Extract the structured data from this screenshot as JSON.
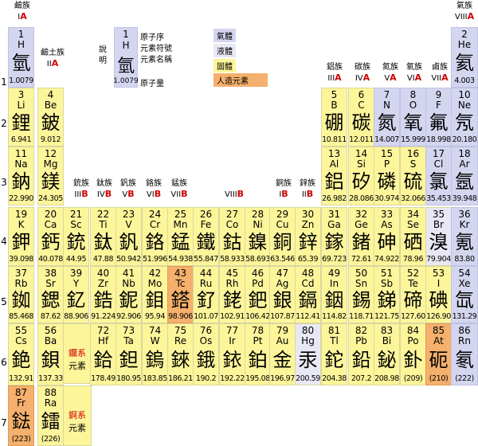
{
  "top_groups": {
    "g1": {
      "cj": "鹼族",
      "rm": "I",
      "ab": "A"
    },
    "g2": {
      "cj": "鹼土族",
      "rm": "II",
      "ab": "A"
    },
    "g13": {
      "cj": "鋁族",
      "rm": "III",
      "ab": "A"
    },
    "g14": {
      "cj": "碳族",
      "rm": "IV",
      "ab": "A"
    },
    "g15": {
      "cj": "氮族",
      "rm": "V",
      "ab": "A"
    },
    "g16": {
      "cj": "氧族",
      "rm": "VI",
      "ab": "A"
    },
    "g17": {
      "cj": "鹵族",
      "rm": "VII",
      "ab": "A"
    },
    "g18": {
      "cj": "氣族",
      "rm": "VIII",
      "ab": "A"
    }
  },
  "transition_groups": [
    {
      "cj": "銃族",
      "rm": "III",
      "ab": "B"
    },
    {
      "cj": "鈦族",
      "rm": "IV",
      "ab": "B"
    },
    {
      "cj": "釩族",
      "rm": "V",
      "ab": "B"
    },
    {
      "cj": "鉻族",
      "rm": "VI",
      "ab": "B"
    },
    {
      "cj": "錳族",
      "rm": "VII",
      "ab": "B"
    },
    {
      "cj": "",
      "rm": "VIII",
      "ab": "B"
    },
    {
      "cj": "銅族",
      "rm": "I",
      "ab": "B"
    },
    {
      "cj": "鋅族",
      "rm": "II",
      "ab": "B"
    }
  ],
  "legend": {
    "side_label": "說明",
    "sample": {
      "num": "1",
      "sym": "H",
      "han": "氫",
      "mass": "1.0079"
    },
    "l1": "原子序",
    "l2": "元素符號",
    "l3": "元素名稱",
    "l4": "原子量",
    "gas": "氣體",
    "liquid": "液體",
    "solid": "固體",
    "synthetic": "人造元素",
    "gas_color": "#d4d6f0",
    "liquid_color": "#e8e8f4",
    "solid_color": "#fdf59a",
    "synth_color": "#f4b06c"
  },
  "row_numbers": [
    "1",
    "2",
    "3",
    "4",
    "5",
    "6",
    "7"
  ],
  "series": {
    "lanthanide": {
      "l1": "鑭系",
      "l2": "元素"
    },
    "actinide": {
      "l1": "錒系",
      "l2": "元素"
    }
  },
  "elements": [
    {
      "n": "1",
      "s": "H",
      "h": "氫",
      "m": "1.0079",
      "r": 1,
      "c": 1,
      "t": "gas"
    },
    {
      "n": "2",
      "s": "He",
      "h": "氦",
      "m": "4.003",
      "r": 1,
      "c": 18,
      "t": "gas"
    },
    {
      "n": "3",
      "s": "Li",
      "h": "鋰",
      "m": "6.941",
      "r": 2,
      "c": 1,
      "t": "solid"
    },
    {
      "n": "4",
      "s": "Be",
      "h": "鈹",
      "m": "9.012",
      "r": 2,
      "c": 2,
      "t": "solid"
    },
    {
      "n": "5",
      "s": "B",
      "h": "硼",
      "m": "10.811",
      "r": 2,
      "c": 13,
      "t": "solid"
    },
    {
      "n": "6",
      "s": "C",
      "h": "碳",
      "m": "12.011",
      "r": 2,
      "c": 14,
      "t": "solid"
    },
    {
      "n": "7",
      "s": "N",
      "h": "氮",
      "m": "14.007",
      "r": 2,
      "c": 15,
      "t": "gas"
    },
    {
      "n": "8",
      "s": "O",
      "h": "氧",
      "m": "15.999",
      "r": 2,
      "c": 16,
      "t": "gas"
    },
    {
      "n": "9",
      "s": "F",
      "h": "氟",
      "m": "18.998",
      "r": 2,
      "c": 17,
      "t": "gas"
    },
    {
      "n": "10",
      "s": "Ne",
      "h": "氖",
      "m": "20.180",
      "r": 2,
      "c": 18,
      "t": "gas"
    },
    {
      "n": "11",
      "s": "Na",
      "h": "鈉",
      "m": "22.990",
      "r": 3,
      "c": 1,
      "t": "solid"
    },
    {
      "n": "12",
      "s": "Mg",
      "h": "鎂",
      "m": "24.305",
      "r": 3,
      "c": 2,
      "t": "solid"
    },
    {
      "n": "13",
      "s": "Al",
      "h": "鋁",
      "m": "26.982",
      "r": 3,
      "c": 13,
      "t": "solid"
    },
    {
      "n": "14",
      "s": "Si",
      "h": "矽",
      "m": "28.086",
      "r": 3,
      "c": 14,
      "t": "solid"
    },
    {
      "n": "15",
      "s": "P",
      "h": "磷",
      "m": "30.974",
      "r": 3,
      "c": 15,
      "t": "solid"
    },
    {
      "n": "16",
      "s": "S",
      "h": "硫",
      "m": "32.066",
      "r": 3,
      "c": 16,
      "t": "solid"
    },
    {
      "n": "17",
      "s": "Cl",
      "h": "氯",
      "m": "35.453",
      "r": 3,
      "c": 17,
      "t": "gas"
    },
    {
      "n": "18",
      "s": "Ar",
      "h": "氬",
      "m": "39.948",
      "r": 3,
      "c": 18,
      "t": "gas"
    },
    {
      "n": "19",
      "s": "K",
      "h": "鉀",
      "m": "39.098",
      "r": 4,
      "c": 1,
      "t": "solid"
    },
    {
      "n": "20",
      "s": "Ca",
      "h": "鈣",
      "m": "40.078",
      "r": 4,
      "c": 2,
      "t": "solid"
    },
    {
      "n": "21",
      "s": "Sc",
      "h": "銃",
      "m": "44.95",
      "r": 4,
      "c": 3,
      "t": "solid"
    },
    {
      "n": "22",
      "s": "Ti",
      "h": "鈦",
      "m": "47.88",
      "r": 4,
      "c": 4,
      "t": "solid"
    },
    {
      "n": "23",
      "s": "V",
      "h": "釩",
      "m": "50.942",
      "r": 4,
      "c": 5,
      "t": "solid"
    },
    {
      "n": "24",
      "s": "Cr",
      "h": "鉻",
      "m": "51.996",
      "r": 4,
      "c": 6,
      "t": "solid"
    },
    {
      "n": "25",
      "s": "Mn",
      "h": "錳",
      "m": "54.938",
      "r": 4,
      "c": 7,
      "t": "solid"
    },
    {
      "n": "26",
      "s": "Fe",
      "h": "鐵",
      "m": "55.847",
      "r": 4,
      "c": 8,
      "t": "solid"
    },
    {
      "n": "27",
      "s": "Co",
      "h": "鈷",
      "m": "58.933",
      "r": 4,
      "c": 9,
      "t": "solid"
    },
    {
      "n": "28",
      "s": "Ni",
      "h": "鎳",
      "m": "58.693",
      "r": 4,
      "c": 10,
      "t": "solid"
    },
    {
      "n": "29",
      "s": "Cu",
      "h": "銅",
      "m": "63.546",
      "r": 4,
      "c": 11,
      "t": "solid"
    },
    {
      "n": "30",
      "s": "Zn",
      "h": "鋅",
      "m": "65.39",
      "r": 4,
      "c": 12,
      "t": "solid"
    },
    {
      "n": "31",
      "s": "Ga",
      "h": "鎵",
      "m": "69.723",
      "r": 4,
      "c": 13,
      "t": "solid"
    },
    {
      "n": "32",
      "s": "Ge",
      "h": "鍺",
      "m": "72.61",
      "r": 4,
      "c": 14,
      "t": "solid"
    },
    {
      "n": "33",
      "s": "As",
      "h": "砷",
      "m": "74.922",
      "r": 4,
      "c": 15,
      "t": "solid"
    },
    {
      "n": "34",
      "s": "Se",
      "h": "硒",
      "m": "78.96",
      "r": 4,
      "c": 16,
      "t": "solid"
    },
    {
      "n": "35",
      "s": "Br",
      "h": "溴",
      "m": "79.904",
      "r": 4,
      "c": 17,
      "t": "liquid"
    },
    {
      "n": "36",
      "s": "Kr",
      "h": "氪",
      "m": "83.80",
      "r": 4,
      "c": 18,
      "t": "gas"
    },
    {
      "n": "37",
      "s": "Rb",
      "h": "銣",
      "m": "85.468",
      "r": 5,
      "c": 1,
      "t": "solid"
    },
    {
      "n": "38",
      "s": "Sr",
      "h": "鍶",
      "m": "87.62",
      "r": 5,
      "c": 2,
      "t": "solid"
    },
    {
      "n": "39",
      "s": "Y",
      "h": "釔",
      "m": "88.906",
      "r": 5,
      "c": 3,
      "t": "solid"
    },
    {
      "n": "40",
      "s": "Zr",
      "h": "鋯",
      "m": "91.224",
      "r": 5,
      "c": 4,
      "t": "solid"
    },
    {
      "n": "41",
      "s": "Nb",
      "h": "鈮",
      "m": "92.906",
      "r": 5,
      "c": 5,
      "t": "solid"
    },
    {
      "n": "42",
      "s": "Mo",
      "h": "鉬",
      "m": "95.94",
      "r": 5,
      "c": 6,
      "t": "solid"
    },
    {
      "n": "43",
      "s": "Tc",
      "h": "鎝",
      "m": "98.906",
      "r": 5,
      "c": 7,
      "t": "synth"
    },
    {
      "n": "44",
      "s": "Ru",
      "h": "釕",
      "m": "101.07",
      "r": 5,
      "c": 8,
      "t": "solid"
    },
    {
      "n": "45",
      "s": "Rh",
      "h": "銠",
      "m": "102.91",
      "r": 5,
      "c": 9,
      "t": "solid"
    },
    {
      "n": "46",
      "s": "Pd",
      "h": "鈀",
      "m": "106.42",
      "r": 5,
      "c": 10,
      "t": "solid"
    },
    {
      "n": "47",
      "s": "Ag",
      "h": "銀",
      "m": "107.87",
      "r": 5,
      "c": 11,
      "t": "solid"
    },
    {
      "n": "48",
      "s": "Cd",
      "h": "鎘",
      "m": "112.41",
      "r": 5,
      "c": 12,
      "t": "solid"
    },
    {
      "n": "49",
      "s": "In",
      "h": "銦",
      "m": "114.82",
      "r": 5,
      "c": 13,
      "t": "solid"
    },
    {
      "n": "50",
      "s": "Sn",
      "h": "錫",
      "m": "118.71",
      "r": 5,
      "c": 14,
      "t": "solid"
    },
    {
      "n": "51",
      "s": "Sb",
      "h": "銻",
      "m": "121.75",
      "r": 5,
      "c": 15,
      "t": "solid"
    },
    {
      "n": "52",
      "s": "Te",
      "h": "碲",
      "m": "127.60",
      "r": 5,
      "c": 16,
      "t": "solid"
    },
    {
      "n": "53",
      "s": "I",
      "h": "碘",
      "m": "126.90",
      "r": 5,
      "c": 17,
      "t": "solid"
    },
    {
      "n": "54",
      "s": "Xe",
      "h": "氙",
      "m": "131.29",
      "r": 5,
      "c": 18,
      "t": "gas"
    },
    {
      "n": "55",
      "s": "Cs",
      "h": "銫",
      "m": "132.91",
      "r": 6,
      "c": 1,
      "t": "solid"
    },
    {
      "n": "56",
      "s": "Ba",
      "h": "鋇",
      "m": "137.33",
      "r": 6,
      "c": 2,
      "t": "solid"
    },
    {
      "n": "72",
      "s": "Hf",
      "h": "鉿",
      "m": "178.49",
      "r": 6,
      "c": 4,
      "t": "solid"
    },
    {
      "n": "73",
      "s": "Ta",
      "h": "鉭",
      "m": "180.95",
      "r": 6,
      "c": 5,
      "t": "solid"
    },
    {
      "n": "74",
      "s": "W",
      "h": "鎢",
      "m": "183.85",
      "r": 6,
      "c": 6,
      "t": "solid"
    },
    {
      "n": "75",
      "s": "Re",
      "h": "錸",
      "m": "186.21",
      "r": 6,
      "c": 7,
      "t": "solid"
    },
    {
      "n": "76",
      "s": "Os",
      "h": "鋨",
      "m": "190.2",
      "r": 6,
      "c": 8,
      "t": "solid"
    },
    {
      "n": "77",
      "s": "Ir",
      "h": "銥",
      "m": "192.22",
      "r": 6,
      "c": 9,
      "t": "solid"
    },
    {
      "n": "78",
      "s": "Pt",
      "h": "鉑",
      "m": "195.08",
      "r": 6,
      "c": 10,
      "t": "solid"
    },
    {
      "n": "79",
      "s": "Au",
      "h": "金",
      "m": "196.97",
      "r": 6,
      "c": 11,
      "t": "solid"
    },
    {
      "n": "80",
      "s": "Hg",
      "h": "汞",
      "m": "200.59",
      "r": 6,
      "c": 12,
      "t": "liquid"
    },
    {
      "n": "81",
      "s": "Tl",
      "h": "鉈",
      "m": "204.38",
      "r": 6,
      "c": 13,
      "t": "solid"
    },
    {
      "n": "82",
      "s": "Pb",
      "h": "鉛",
      "m": "207.2",
      "r": 6,
      "c": 14,
      "t": "solid"
    },
    {
      "n": "83",
      "s": "Bi",
      "h": "鉍",
      "m": "208.98",
      "r": 6,
      "c": 15,
      "t": "solid"
    },
    {
      "n": "84",
      "s": "Po",
      "h": "釙",
      "m": "(209)",
      "r": 6,
      "c": 16,
      "t": "solid"
    },
    {
      "n": "85",
      "s": "At",
      "h": "砈",
      "m": "(210)",
      "r": 6,
      "c": 17,
      "t": "synth"
    },
    {
      "n": "86",
      "s": "Rn",
      "h": "氡",
      "m": "(222)",
      "r": 6,
      "c": 18,
      "t": "gas"
    },
    {
      "n": "87",
      "s": "Fr",
      "h": "鍅",
      "m": "(223)",
      "r": 7,
      "c": 1,
      "t": "synth"
    },
    {
      "n": "88",
      "s": "Ra",
      "h": "鐳",
      "m": "(226)",
      "r": 7,
      "c": 2,
      "t": "solid"
    }
  ]
}
